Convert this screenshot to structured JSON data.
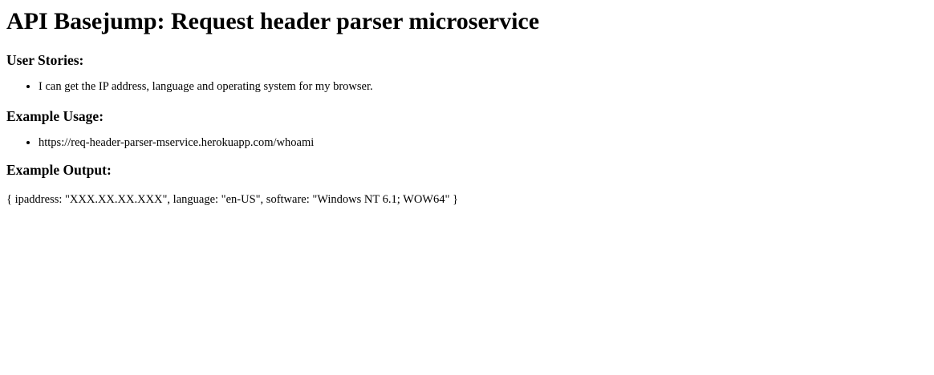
{
  "page": {
    "title": "API Basejump: Request header parser microservice"
  },
  "sections": {
    "user_stories": {
      "heading": "User Stories:",
      "items": [
        "I can get the IP address, language and operating system for my browser."
      ]
    },
    "example_usage": {
      "heading": "Example Usage:",
      "items": [
        "https://req-header-parser-mservice.herokuapp.com/whoami"
      ]
    },
    "example_output": {
      "heading": "Example Output:",
      "text": "{ ipaddress: \"XXX.XX.XX.XXX\", language: \"en-US\", software: \"Windows NT 6.1; WOW64\" }"
    }
  }
}
